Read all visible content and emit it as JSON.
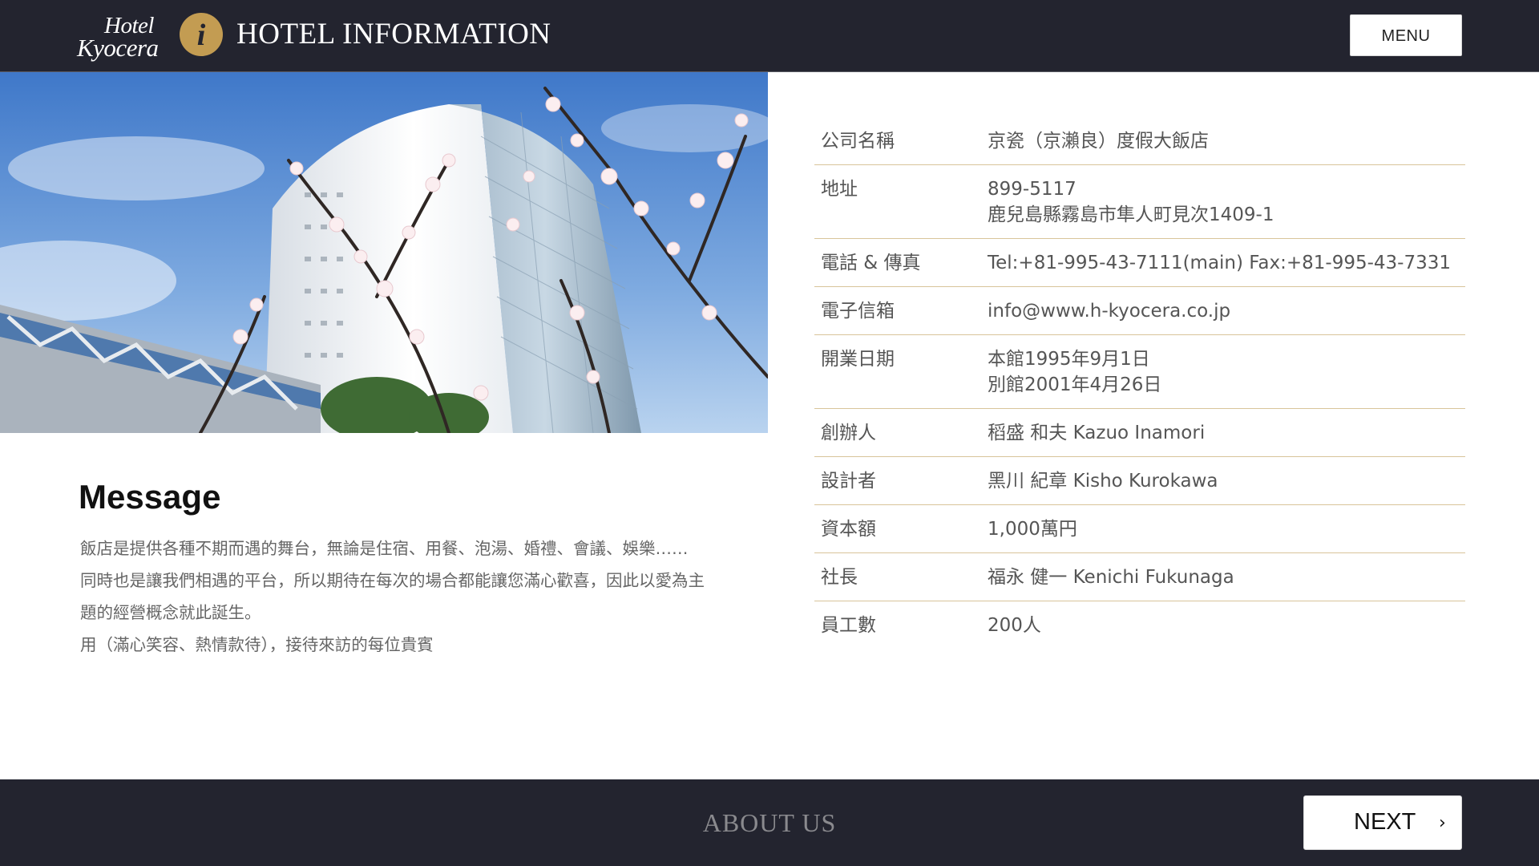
{
  "header": {
    "logo_line1": "Hotel",
    "logo_line2": "Kyocera",
    "info_icon": "i",
    "title": "HOTEL INFORMATION",
    "menu_label": "MENU"
  },
  "hero": {
    "description_icon": "hotel-building-cherry-blossom-photo"
  },
  "message": {
    "title": "Message",
    "lines": [
      "飯店是提供各種不期而遇的舞台，無論是住宿、用餐、泡湯、婚禮、會議、娛樂……",
      "同時也是讓我們相遇的平台，所以期待在每次的場合都能讓您滿心歡喜，因此以愛為主",
      "題的經營概念就此誕生。",
      "用（滿心笑容、熱情款待），接待來訪的每位貴賓"
    ]
  },
  "info": [
    {
      "key": "公司名稱",
      "value": [
        "京瓷（京瀨良）度假大飯店"
      ]
    },
    {
      "key": "地址",
      "value": [
        "899-5117",
        "鹿兒島縣霧島市隼人町見次1409-1"
      ]
    },
    {
      "key": "電話 & 傳真",
      "value": [
        "Tel:+81-995-43-7111(main) Fax:+81-995-43-7331"
      ]
    },
    {
      "key": "電子信箱",
      "value": [
        "info@www.h-kyocera.co.jp"
      ]
    },
    {
      "key": "開業日期",
      "value": [
        "本館1995年9月1日",
        "別館2001年4月26日"
      ]
    },
    {
      "key": "創辦人",
      "value": [
        "稻盛 和夫  Kazuo Inamori"
      ]
    },
    {
      "key": "設計者",
      "value": [
        "黑川 紀章  Kisho Kurokawa"
      ]
    },
    {
      "key": "資本額",
      "value": [
        "1,000萬円"
      ]
    },
    {
      "key": "社長",
      "value": [
        "福永 健一  Kenichi Fukunaga"
      ]
    },
    {
      "key": "員工數",
      "value": [
        "200人"
      ]
    }
  ],
  "footer": {
    "title": "ABOUT US",
    "next_label": "NEXT",
    "next_icon": "chevron-right-icon"
  }
}
